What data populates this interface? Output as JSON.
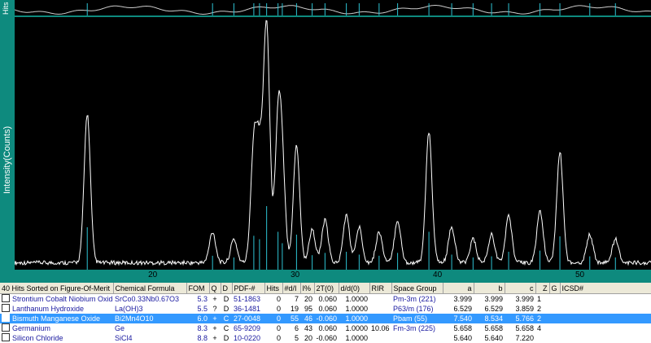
{
  "top_panel": {
    "axis_label": "Hits"
  },
  "main_panel": {
    "y_label": "Intensity(Counts)",
    "x_ticks": [
      "20",
      "30",
      "40",
      "50"
    ],
    "x_tick_values": [
      20,
      30,
      40,
      50
    ]
  },
  "chart_data": {
    "type": "line",
    "xlabel": "",
    "ylabel": "Intensity(Counts)",
    "xlim": [
      10.3,
      55
    ],
    "peaks_2theta": [
      15.4,
      24.2,
      25.7,
      27.1,
      27.5,
      28.0,
      28.8,
      29.1,
      30.1,
      31.2,
      32.1,
      33.6,
      34.5,
      35.9,
      37.2,
      39.4,
      41.0,
      42.5,
      43.8,
      45.0,
      47.2,
      48.6,
      50.7,
      52.5
    ],
    "peaks_intensity": [
      0.63,
      0.13,
      0.1,
      0.48,
      0.42,
      1.0,
      0.55,
      0.35,
      0.5,
      0.14,
      0.18,
      0.2,
      0.15,
      0.13,
      0.18,
      0.55,
      0.15,
      0.1,
      0.12,
      0.2,
      0.22,
      0.47,
      0.12,
      0.1
    ]
  },
  "table": {
    "header": [
      "40 Hits Sorted on Figure-Of-Merit",
      "Chemical Formula",
      "FOM",
      "Q",
      "D",
      "PDF-#",
      "Hits",
      "#d/I",
      "I%",
      "2T(0)",
      "d/d(0)",
      "RIR",
      "Space Group",
      "a",
      "b",
      "c",
      "Z",
      "G",
      "ICSD#"
    ],
    "rows": [
      {
        "name": "Strontium Cobalt Niobium Oxide",
        "formula": "SrCo0.33Nb0.67O3",
        "fom": "5.3",
        "q": "+",
        "d": "D",
        "pdf": "51-1863",
        "hits": "0",
        "dl": "7",
        "ip": "20",
        "t0": "0.060",
        "dd0": "1.0000",
        "rir": "",
        "sg": "Pm-3m (221)",
        "a": "3.999",
        "b": "3.999",
        "c": "3.999",
        "z": "1",
        "g": "",
        "icsd": ""
      },
      {
        "name": "Lanthanum Hydroxide",
        "formula": "La(OH)3",
        "fom": "5.5",
        "q": "?",
        "d": "D",
        "pdf": "36-1481",
        "hits": "0",
        "dl": "19",
        "ip": "95",
        "t0": "0.060",
        "dd0": "1.0000",
        "rir": "",
        "sg": "P63/m (176)",
        "a": "6.529",
        "b": "6.529",
        "c": "3.859",
        "z": "2",
        "g": "",
        "icsd": ""
      },
      {
        "name": "Bismuth Manganese Oxide",
        "formula": "Bi2Mn4O10",
        "fom": "6.0",
        "q": "+",
        "d": "C",
        "pdf": "27-0048",
        "hits": "0",
        "dl": "55",
        "ip": "46",
        "t0": "-0.060",
        "dd0": "1.0000",
        "rir": "",
        "sg": "Pbam (55)",
        "a": "7.540",
        "b": "8.534",
        "c": "5.766",
        "z": "2",
        "g": "",
        "icsd": ""
      },
      {
        "name": "Germanium",
        "formula": "Ge",
        "fom": "8.3",
        "q": "+",
        "d": "C",
        "pdf": "65-9209",
        "hits": "0",
        "dl": "6",
        "ip": "43",
        "t0": "0.060",
        "dd0": "1.0000",
        "rir": "10.06",
        "sg": "Fm-3m (225)",
        "a": "5.658",
        "b": "5.658",
        "c": "5.658",
        "z": "4",
        "g": "",
        "icsd": ""
      },
      {
        "name": "Silicon Chloride",
        "formula": "SiCl4",
        "fom": "8.8",
        "q": "+",
        "d": "D",
        "pdf": "10-0220",
        "hits": "0",
        "dl": "5",
        "ip": "20",
        "t0": "-0.060",
        "dd0": "1.0000",
        "rir": "",
        "sg": "",
        "a": "5.640",
        "b": "5.640",
        "c": "7.220",
        "z": "",
        "g": "",
        "icsd": ""
      }
    ],
    "selected_index": 2
  },
  "colors": {
    "background": "#0e8a7e",
    "plot_bg": "#000000",
    "trace": "#ffffff",
    "reference": "#2ec4d4",
    "selected_row": "#3399ff"
  }
}
